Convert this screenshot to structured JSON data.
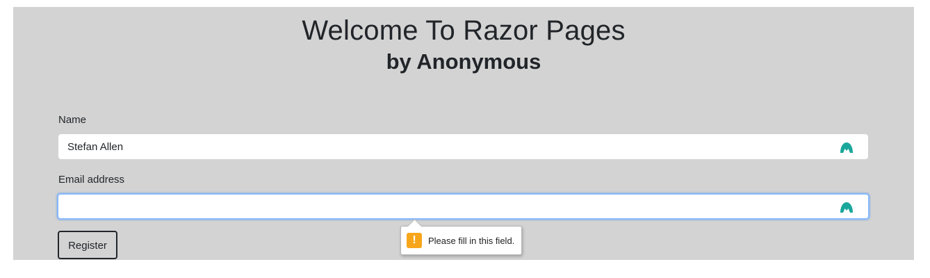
{
  "header": {
    "title": "Welcome To Razor Pages",
    "subtitle": "by Anonymous"
  },
  "form": {
    "name_label": "Name",
    "name_value": "Stefan Allen",
    "email_label": "Email address",
    "email_value": "",
    "register_label": "Register"
  },
  "validation": {
    "message": "Please fill in this field.",
    "icon": "!"
  },
  "icons": {
    "field_extension": "nordpass-autofill-icon",
    "warning": "warning-icon"
  },
  "colors": {
    "page_background": "#d3d3d3",
    "focus_ring": "#86b7fe",
    "extension_icon": "#1aa79b",
    "warning": "#f7a61b"
  }
}
